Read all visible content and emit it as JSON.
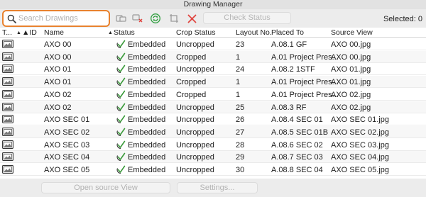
{
  "window": {
    "title": "Drawing Manager"
  },
  "toolbar": {
    "search_placeholder": "Search Drawings",
    "check_status_label": "Check Status",
    "selected_label": "Selected: 0",
    "icons": [
      "link-drawing-icon",
      "unlink-drawing-icon",
      "update-icon",
      "crop-icon",
      "delete-icon"
    ]
  },
  "table": {
    "columns": [
      "T...",
      "ID",
      "Name",
      "Status",
      "Crop Status",
      "Layout No.",
      "Placed To",
      "Source View"
    ],
    "rows": [
      {
        "name": "AXO 00",
        "status": "Embedded",
        "crop": "Uncropped",
        "layout": "23",
        "placed": "A.08.1 GF",
        "source": "AXO 00.jpg"
      },
      {
        "name": "AXO 00",
        "status": "Embedded",
        "crop": "Cropped",
        "layout": "1",
        "placed": "A.01 Project Pres...",
        "source": "AXO 00.jpg"
      },
      {
        "name": "AXO 01",
        "status": "Embedded",
        "crop": "Uncropped",
        "layout": "24",
        "placed": "A.08.2 1STF",
        "source": "AXO 01.jpg"
      },
      {
        "name": "AXO 01",
        "status": "Embedded",
        "crop": "Cropped",
        "layout": "1",
        "placed": "A.01 Project Pres...",
        "source": "AXO 01.jpg"
      },
      {
        "name": "AXO 02",
        "status": "Embedded",
        "crop": "Cropped",
        "layout": "1",
        "placed": "A.01 Project Pres...",
        "source": "AXO 02.jpg"
      },
      {
        "name": "AXO 02",
        "status": "Embedded",
        "crop": "Uncropped",
        "layout": "25",
        "placed": "A.08.3 RF",
        "source": "AXO 02.jpg"
      },
      {
        "name": "AXO SEC 01",
        "status": "Embedded",
        "crop": "Uncropped",
        "layout": "26",
        "placed": "A.08.4 SEC 01",
        "source": "AXO SEC 01.jpg"
      },
      {
        "name": "AXO SEC 02",
        "status": "Embedded",
        "crop": "Uncropped",
        "layout": "27",
        "placed": "A.08.5 SEC 01B",
        "source": "AXO SEC 02.jpg"
      },
      {
        "name": "AXO SEC 03",
        "status": "Embedded",
        "crop": "Uncropped",
        "layout": "28",
        "placed": "A.08.6 SEC 02",
        "source": "AXO SEC 03.jpg"
      },
      {
        "name": "AXO SEC 04",
        "status": "Embedded",
        "crop": "Uncropped",
        "layout": "29",
        "placed": "A.08.7 SEC 03",
        "source": "AXO SEC 04.jpg"
      },
      {
        "name": "AXO SEC 05",
        "status": "Embedded",
        "crop": "Uncropped",
        "layout": "30",
        "placed": "A.08.8 SEC 04",
        "source": "AXO SEC 05.jpg"
      }
    ]
  },
  "bottom": {
    "open_source_view_label": "Open source View",
    "settings_label": "Settings..."
  },
  "colors": {
    "search_focus": "#e8822f",
    "status_check": "#3a9a3a",
    "delete": "#e0453f",
    "update": "#2f9e3f"
  }
}
